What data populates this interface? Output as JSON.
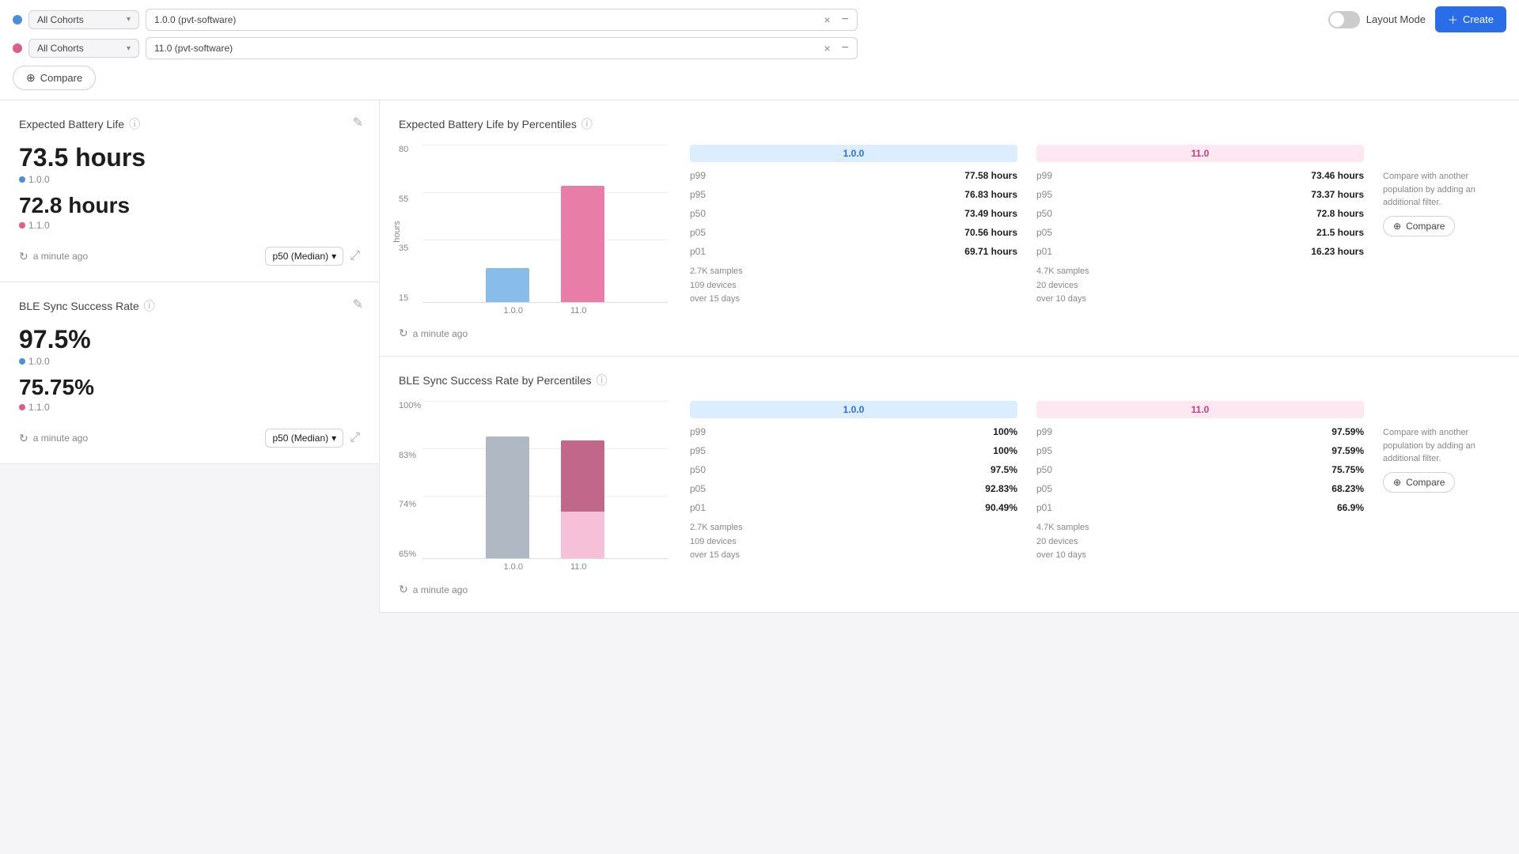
{
  "header": {
    "cohort1": {
      "dot": "blue",
      "select_label": "All Cohorts",
      "version_label": "1.0.0 (pvt-software)",
      "collapse_icon": "−"
    },
    "cohort2": {
      "dot": "pink",
      "select_label": "All Cohorts",
      "version_label": "11.0 (pvt-software)",
      "collapse_icon": "−"
    },
    "compare_btn": "Compare",
    "layout_mode_label": "Layout Mode",
    "create_btn": "Create"
  },
  "battery_life": {
    "title": "Expected Battery Life",
    "value1": "73.5 hours",
    "label1": "1.0.0",
    "value2": "72.8 hours",
    "label2": "1.1.0",
    "refresh": "a minute ago",
    "percentile": "p50 (Median)",
    "chart_title": "Expected Battery Life by Percentiles",
    "chart": {
      "y_labels": [
        "80",
        "55",
        "35",
        "15"
      ],
      "x_labels": [
        "1.0.0",
        "11.0"
      ],
      "bar1_height_pct": 22,
      "bar2_height_pct": 75,
      "y_axis_label": "hours"
    },
    "stats_1_0_0": {
      "header": "1.0.0",
      "p99": "77.58 hours",
      "p95": "76.83 hours",
      "p50": "73.49 hours",
      "p05": "70.56 hours",
      "p01": "69.71 hours",
      "samples": "2.7K samples",
      "devices": "109 devices",
      "period": "over 15 days"
    },
    "stats_1_1_0": {
      "header": "11.0",
      "p99": "73.46 hours",
      "p95": "73.37 hours",
      "p50": "72.8 hours",
      "p05": "21.5 hours",
      "p01": "16.23 hours",
      "samples": "4.7K samples",
      "devices": "20 devices",
      "period": "over 10 days"
    },
    "compare_text": "Compare with another population by adding an additional filter.",
    "compare_btn": "Compare"
  },
  "ble_sync": {
    "title": "BLE Sync Success Rate",
    "value1": "97.5%",
    "label1": "1.0.0",
    "value2": "75.75%",
    "label2": "1.1.0",
    "refresh": "a minute ago",
    "percentile": "p50 (Median)",
    "chart_title": "BLE Sync Success Rate by Percentiles",
    "chart": {
      "y_labels": [
        "100%",
        "83%",
        "74%",
        "65%"
      ],
      "x_labels": [
        "1.0.0",
        "11.0"
      ]
    },
    "stats_1_0_0": {
      "header": "1.0.0",
      "p99": "100%",
      "p95": "100%",
      "p50": "97.5%",
      "p05": "92.83%",
      "p01": "90.49%",
      "samples": "2.7K samples",
      "devices": "109 devices",
      "period": "over 15 days"
    },
    "stats_1_1_0": {
      "header": "11.0",
      "p99": "97.59%",
      "p95": "97.59%",
      "p50": "75.75%",
      "p05": "68.23%",
      "p01": "66.9%",
      "samples": "4.7K samples",
      "devices": "20 devices",
      "period": "over 10 days"
    },
    "compare_text": "Compare with another population by adding an additional filter.",
    "compare_btn": "Compare"
  }
}
